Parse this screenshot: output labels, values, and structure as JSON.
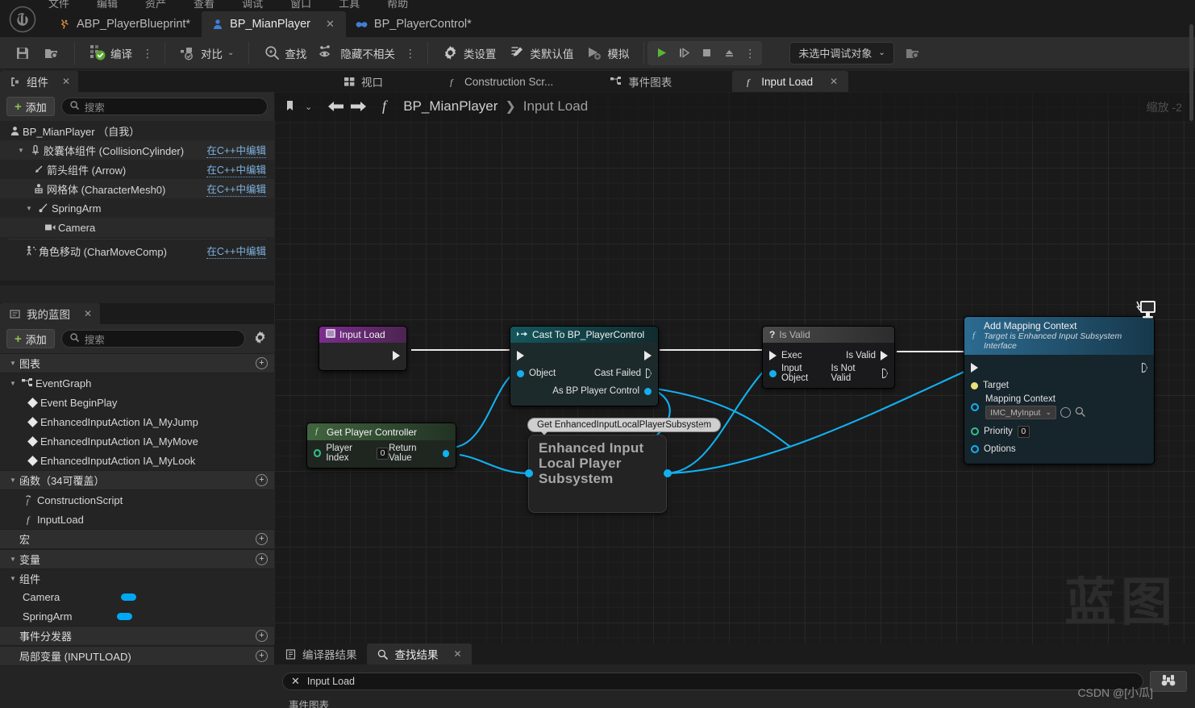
{
  "menubar": {
    "items": [
      "文件",
      "编辑",
      "资产",
      "查看",
      "调试",
      "窗口",
      "工具",
      "帮助"
    ]
  },
  "tabs": [
    {
      "label": "ABP_PlayerBlueprint*",
      "icon": "animation-icon",
      "active": false,
      "closable": false
    },
    {
      "label": "BP_MianPlayer",
      "icon": "character-icon",
      "active": true,
      "closable": true,
      "close": "✕"
    },
    {
      "label": "BP_PlayerControl*",
      "icon": "gamepad-icon",
      "active": false,
      "closable": false
    }
  ],
  "toolbar": {
    "save_icon": "save-icon",
    "browse_icon": "browse-content-icon",
    "compile_label": "编译",
    "diff_label": "对比",
    "find_label": "查找",
    "hide_unrelated_label": "隐藏不相关",
    "class_settings_label": "类设置",
    "class_defaults_label": "类默认值",
    "simulate_label": "模拟",
    "kebab": "⋮",
    "play_icon": "play-icon",
    "step_icon": "step-icon",
    "stop_icon": "stop-icon",
    "eject_icon": "eject-icon",
    "debug_target": "未选中调试对象",
    "debug_browse_icon": "browse-debug-icon"
  },
  "components_panel": {
    "tab_label": "组件",
    "tab_icon": "components-icon",
    "close": "✕",
    "add_label": "添加",
    "search_placeholder": "搜索",
    "items": [
      {
        "label": "BP_MianPlayer （自我）",
        "icon": "character-icon",
        "indent": 0,
        "arrow": "",
        "cpp": ""
      },
      {
        "label": "胶囊体组件 (CollisionCylinder)",
        "icon": "capsule-icon",
        "indent": 1,
        "arrow": "▼",
        "cpp": "在C++中编辑"
      },
      {
        "label": "箭头组件 (Arrow)",
        "icon": "arrow-icon",
        "indent": 2,
        "arrow": "",
        "cpp": "在C++中编辑"
      },
      {
        "label": "网格体 (CharacterMesh0)",
        "icon": "mesh-icon",
        "indent": 2,
        "arrow": "",
        "cpp": "在C++中编辑"
      },
      {
        "label": "SpringArm",
        "icon": "springarm-icon",
        "indent": 2,
        "arrow": "▼",
        "cpp": ""
      },
      {
        "label": "Camera",
        "icon": "camera-icon",
        "indent": 3,
        "arrow": "",
        "cpp": ""
      },
      {
        "label": "角色移动 (CharMoveComp)",
        "icon": "movement-icon",
        "indent": 1,
        "arrow": "",
        "cpp": "在C++中编辑"
      }
    ]
  },
  "myblueprint_panel": {
    "tab_label": "我的蓝图",
    "tab_icon": "blueprint-icon",
    "close": "✕",
    "add_label": "添加",
    "search_placeholder": "搜索",
    "gear_icon": "gear-icon",
    "sections": [
      {
        "title": "图表",
        "arrow": "▼",
        "plus": "+",
        "items": [
          {
            "label": "EventGraph",
            "icon": "eventgraph-icon",
            "indent": 0,
            "arrow": "▼"
          },
          {
            "label": "Event BeginPlay",
            "icon": "event-diamond-icon",
            "indent": 1,
            "arrow": ""
          },
          {
            "label": "EnhancedInputAction IA_MyJump",
            "icon": "event-diamond-icon",
            "indent": 1,
            "arrow": ""
          },
          {
            "label": "EnhancedInputAction IA_MyMove",
            "icon": "event-diamond-icon",
            "indent": 1,
            "arrow": ""
          },
          {
            "label": "EnhancedInputAction IA_MyLook",
            "icon": "event-diamond-icon",
            "indent": 1,
            "arrow": ""
          }
        ]
      },
      {
        "title": "函数（34可覆盖）",
        "arrow": "▼",
        "plus": "+",
        "items": [
          {
            "label": "ConstructionScript",
            "icon": "construction-function-icon",
            "indent": 1,
            "arrow": ""
          },
          {
            "label": "InputLoad",
            "icon": "function-icon",
            "indent": 1,
            "arrow": ""
          }
        ]
      },
      {
        "title": "宏",
        "arrow": "",
        "plus": "+",
        "items": []
      },
      {
        "title": "变量",
        "arrow": "▼",
        "plus": "+",
        "items": []
      },
      {
        "title": "组件",
        "arrow": "▼",
        "plus": "",
        "items": [
          {
            "label": "Camera",
            "icon": "",
            "indent": 1,
            "arrow": "",
            "pill": true
          },
          {
            "label": "SpringArm",
            "icon": "",
            "indent": 1,
            "arrow": "",
            "pill": true
          }
        ]
      },
      {
        "title": "事件分发器",
        "arrow": "",
        "plus": "+",
        "items": []
      },
      {
        "title": "局部变量 (INPUTLOAD)",
        "arrow": "",
        "plus": "+",
        "items": []
      }
    ]
  },
  "graph": {
    "tabs": [
      {
        "label": "视口",
        "icon": "viewport-icon",
        "active": false
      },
      {
        "label": "Construction Scr...",
        "icon": "function-icon",
        "active": false
      },
      {
        "label": "事件图表",
        "icon": "eventgraph-icon",
        "active": false
      },
      {
        "label": "Input Load",
        "icon": "function-icon",
        "active": true,
        "close": "✕"
      }
    ],
    "breadcrumb": {
      "bookmark_icon": "bookmark-icon",
      "chevron": "⌄",
      "back_icon": "back-arrow-icon",
      "forward_icon": "forward-arrow-icon",
      "fx_icon": "function-icon",
      "root": "BP_MianPlayer",
      "separator": "❯",
      "current": "Input Load"
    },
    "zoom_label": "缩放 -2",
    "watermark": "蓝图",
    "nodes": {
      "input_load": {
        "title": "Input Load",
        "icon": "entry-node-icon",
        "out_exec": "exec-out-pin"
      },
      "cast": {
        "title": "Cast To BP_PlayerControl",
        "icon": "cast-icon",
        "in_exec": "exec-in-pin",
        "out_exec": "exec-out-pin",
        "pins_left": [
          {
            "label": "Object",
            "type": "object"
          }
        ],
        "pins_right": [
          {
            "label": "Cast Failed",
            "type": "exec"
          },
          {
            "label": "As BP Player Control",
            "type": "object"
          }
        ]
      },
      "is_valid": {
        "title": "Is Valid",
        "icon": "question-icon",
        "pins_left": [
          {
            "label": "Exec",
            "type": "exec"
          },
          {
            "label": "Input Object",
            "type": "object"
          }
        ],
        "pins_right": [
          {
            "label": "Is Valid",
            "type": "exec"
          },
          {
            "label": "Is Not Valid",
            "type": "exec"
          }
        ]
      },
      "get_player_controller": {
        "title": "Get Player Controller",
        "icon": "function-icon",
        "pins_left": [
          {
            "label": "Player Index",
            "type": "int",
            "value": "0"
          }
        ],
        "pins_right": [
          {
            "label": "Return Value",
            "type": "object"
          }
        ]
      },
      "get_subsystem": {
        "tooltip": "Get EnhancedInputLocalPlayerSubsystem",
        "body": "Enhanced Input Local Player Subsystem"
      },
      "add_mapping_context": {
        "title": "Add Mapping Context",
        "subtitle": "Target is Enhanced Input Subsystem Interface",
        "icon": "function-icon",
        "dev_badge": "development-only-icon",
        "pins_left": [
          {
            "label": "Target",
            "type": "object"
          },
          {
            "label": "Mapping Context",
            "type": "object",
            "value": "IMC_MyInput"
          },
          {
            "label": "Priority",
            "type": "int",
            "value": "0"
          },
          {
            "label": "Options",
            "type": "struct"
          }
        ]
      }
    }
  },
  "bottom_panel": {
    "tabs": [
      {
        "label": "编译器结果",
        "icon": "compiler-results-icon",
        "active": false
      },
      {
        "label": "查找结果",
        "icon": "search-icon",
        "active": true,
        "close": "✕"
      }
    ],
    "find_value": "Input Load",
    "clear_icon": "clear-x-icon",
    "find_button_icon": "binoculars-icon",
    "result_text": "事件图表"
  },
  "csdn_watermark": "CSDN @[小瓜]",
  "colors": {
    "accent_blue": "#12b0f0",
    "compile_green": "#8bc34a",
    "play_green": "#5ab733",
    "cast_teal": "#14575c",
    "entry_purple": "#7b2d8e",
    "function_green": "#41643f",
    "amc_blue": "#2c6b91"
  }
}
